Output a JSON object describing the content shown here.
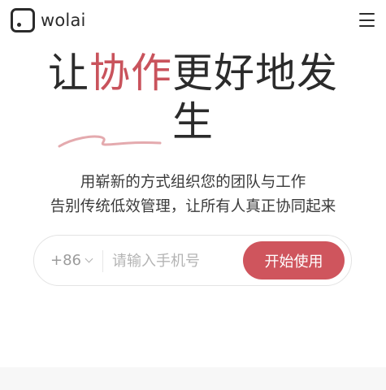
{
  "header": {
    "logo_text": "wolai",
    "menu_icon": "hamburger-menu-icon"
  },
  "hero": {
    "title_pre": "让",
    "title_accent": "协作",
    "title_post": "更好地发",
    "title_line2": "生",
    "accent_color": "#c9535c"
  },
  "subtitle": {
    "line1": "用崭新的方式组织您的团队与工作",
    "line2": "告别传统低效管理，让所有人真正协同起来"
  },
  "signup": {
    "country_code": "+86",
    "phone_placeholder": "请输入手机号",
    "button_label": "开始使用",
    "button_color": "#cf555d"
  }
}
